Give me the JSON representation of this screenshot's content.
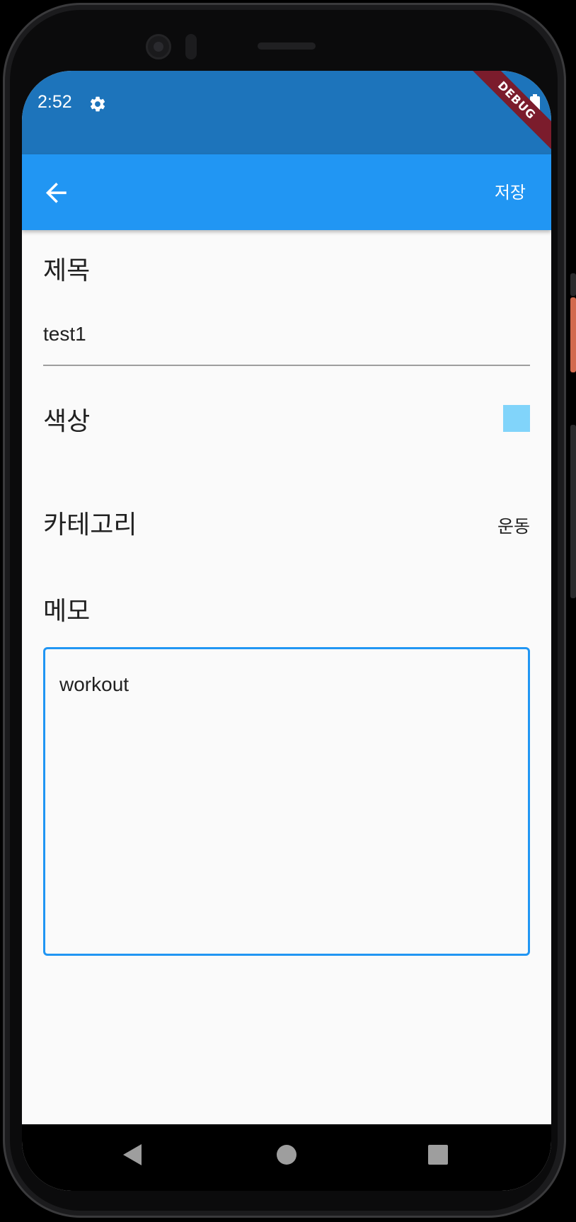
{
  "status_bar": {
    "time": "2:52",
    "settings_icon": "gear-icon",
    "battery_icon": "battery-icon"
  },
  "debug_banner": "DEBUG",
  "app_bar": {
    "back_icon": "arrow-left-icon",
    "save_label": "저장",
    "background_color": "#2196f3"
  },
  "form": {
    "title_label": "제목",
    "title_value": "test1",
    "color_label": "색상",
    "color_value": "#81d4fa",
    "category_label": "카테고리",
    "category_value": "운동",
    "memo_label": "메모",
    "memo_value": "workout",
    "memo_border_color": "#2196f3"
  },
  "nav_bar": {
    "back_icon": "triangle-back-icon",
    "home_icon": "circle-home-icon",
    "recents_icon": "square-recents-icon"
  }
}
